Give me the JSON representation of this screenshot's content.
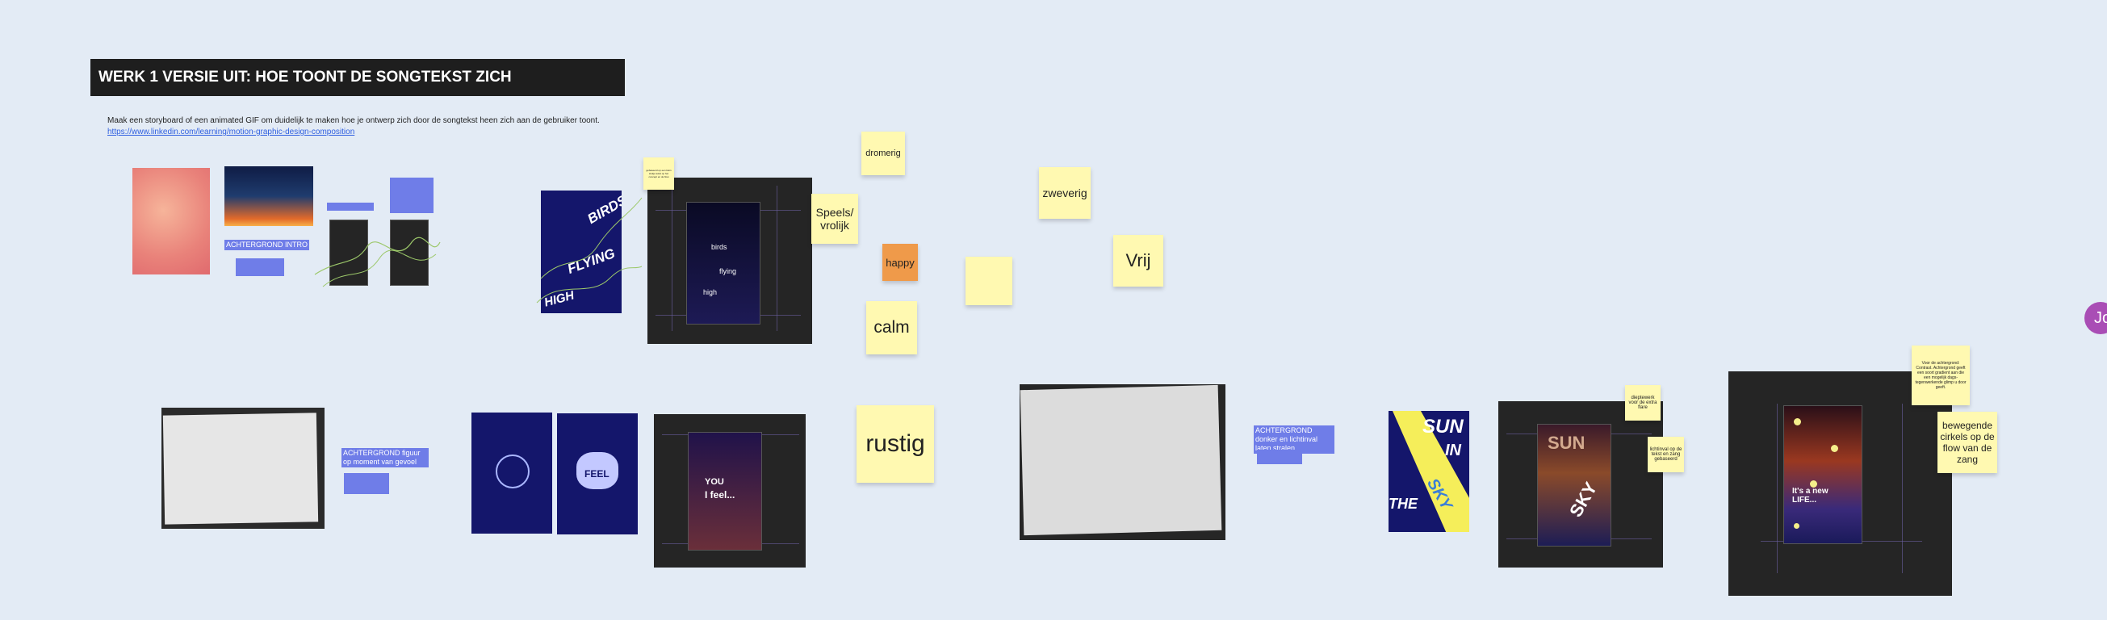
{
  "board": {
    "title": "WERK 1 VERSIE UIT: HOE TOONT DE SONGTEKST ZICH",
    "description": "Maak een storyboard of een animated GIF om duidelijk te maken hoe je ontwerp zich door de songtekst heen zich aan de gebruiker toont.",
    "link": "https://www.linkedin.com/learning/motion-graphic-design-composition"
  },
  "labels": {
    "bg_intro": "ACHTERGROND INTRO",
    "bg_figure": "ACHTERGROND figuur op moment van gevoel",
    "bg_dark": "ACHTERGROND donker en lichtinval laten stralen"
  },
  "stickies": {
    "dromerig": "dromerig",
    "speels": "Speels/ vrolijk",
    "happy": "happy",
    "calm": "calm",
    "zweverig": "zweverig",
    "vrij": "Vrij",
    "rustig": "rustig",
    "diepte": "dieptewerk voor de extra flare",
    "lichtinval": "lichtinval op de tekst en zang gebaseerd",
    "contrast": "Voor de achtergrond: Contrast. Achtergrond geeft een soort gradient aan die een mogelijk dags-tegenwerkende glimp u door geeft.",
    "bewegende": "bewegende cirkels op de flow van de zang",
    "small_note": "gebaseerd op een klein stukje tekst op het concept en de flow"
  },
  "posters": {
    "birds": [
      "BIRDS",
      "FLYING",
      "HIGH"
    ],
    "birds_small": [
      "birds",
      "flying",
      "high"
    ],
    "you": "YOU",
    "i_feel": "I feel...",
    "feel": "FEEL",
    "sun": [
      "SUN",
      "IN",
      "THE",
      "SKY"
    ],
    "new_life": "It's a new LIFE..."
  },
  "user": {
    "avatar_initial": "Jo"
  },
  "colors": {
    "background": "#e3ebf5",
    "sticky": "#fff9b1",
    "sticky_orange": "#ef9a4a",
    "highlight": "#6f7de8",
    "navy": "#14166b",
    "dark": "#252525",
    "avatar": "#a94db5"
  }
}
